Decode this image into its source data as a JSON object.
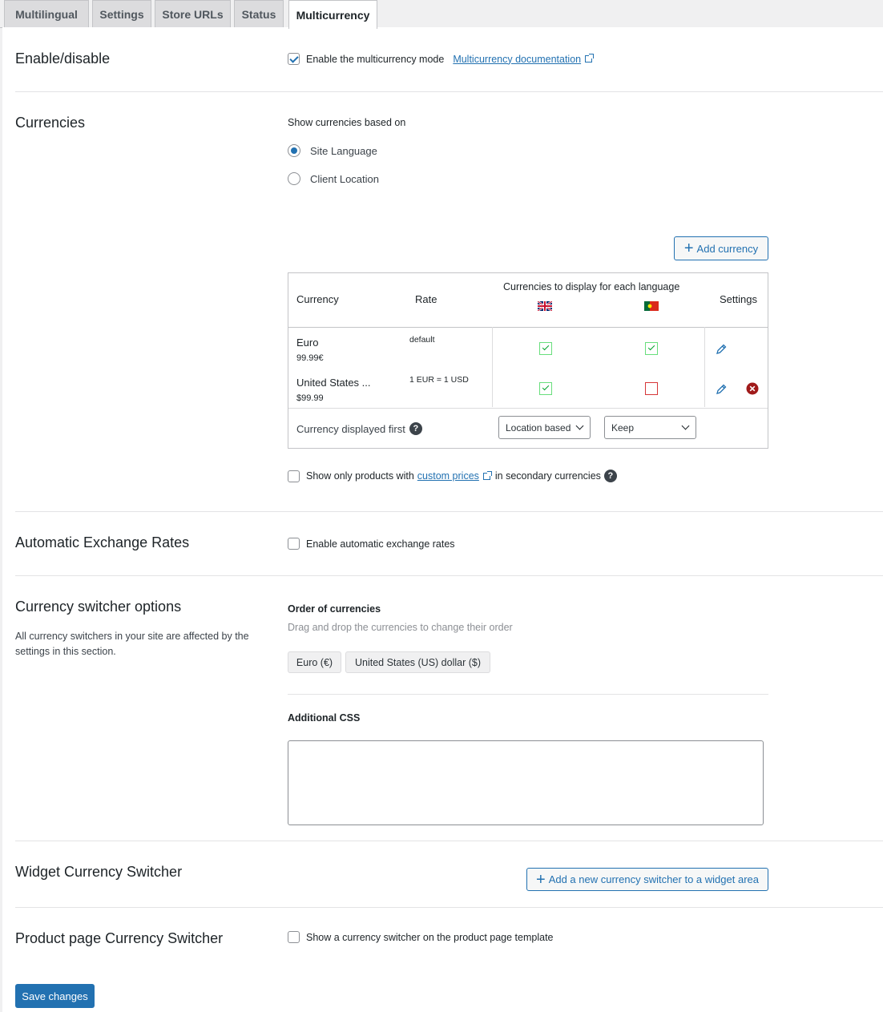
{
  "tabs": [
    {
      "label": "Multilingual"
    },
    {
      "label": "Settings"
    },
    {
      "label": "Store URLs"
    },
    {
      "label": "Status"
    },
    {
      "label": "Multicurrency"
    }
  ],
  "enable_section": {
    "heading": "Enable/disable",
    "checkbox_label": "Enable the multicurrency mode",
    "checked": true,
    "doc_link": "Multicurrency documentation"
  },
  "currencies_section": {
    "heading": "Currencies",
    "show_based_on": "Show currencies based on",
    "options": [
      {
        "label": "Site Language",
        "selected": true
      },
      {
        "label": "Client Location",
        "selected": false
      }
    ],
    "add_currency": "Add currency",
    "table": {
      "col_currency": "Currency",
      "col_rate": "Rate",
      "col_languages": "Currencies to display for each language",
      "col_settings": "Settings",
      "rows": [
        {
          "name": "Euro",
          "price": "99.99€",
          "rate": "default",
          "lang_en": true,
          "lang_pt": true
        },
        {
          "name": "United States ...",
          "price": "$99.99",
          "rate": "1 EUR = 1 USD",
          "lang_en": true,
          "lang_pt": false
        }
      ],
      "displayed_first_label": "Currency displayed first",
      "select_en": "Location based",
      "select_pt": "Keep"
    },
    "custom_prices": {
      "prefix": "Show only products with",
      "link": "custom prices",
      "suffix": "in secondary currencies",
      "checked": false
    }
  },
  "auto_rates": {
    "heading": "Automatic Exchange Rates",
    "checkbox_label": "Enable automatic exchange rates",
    "checked": false
  },
  "switcher_options": {
    "heading": "Currency switcher options",
    "description": "All currency switchers in your site are affected by the settings in this section.",
    "order_title": "Order of currencies",
    "order_hint": "Drag and drop the currencies to change their order",
    "chips": [
      "Euro (€)",
      "United States (US) dollar ($)"
    ],
    "css_title": "Additional CSS",
    "css_value": ""
  },
  "widget_switcher": {
    "heading": "Widget Currency Switcher",
    "button": "Add a new currency switcher to a widget area"
  },
  "product_switcher": {
    "heading": "Product page Currency Switcher",
    "checkbox_label": "Show a currency switcher on the product page template",
    "checked": false
  },
  "save_button": "Save changes",
  "colors": {
    "accent": "#2271b1",
    "success": "#00a32a",
    "danger": "#d63638",
    "delete_icon": "#a01a1a"
  }
}
